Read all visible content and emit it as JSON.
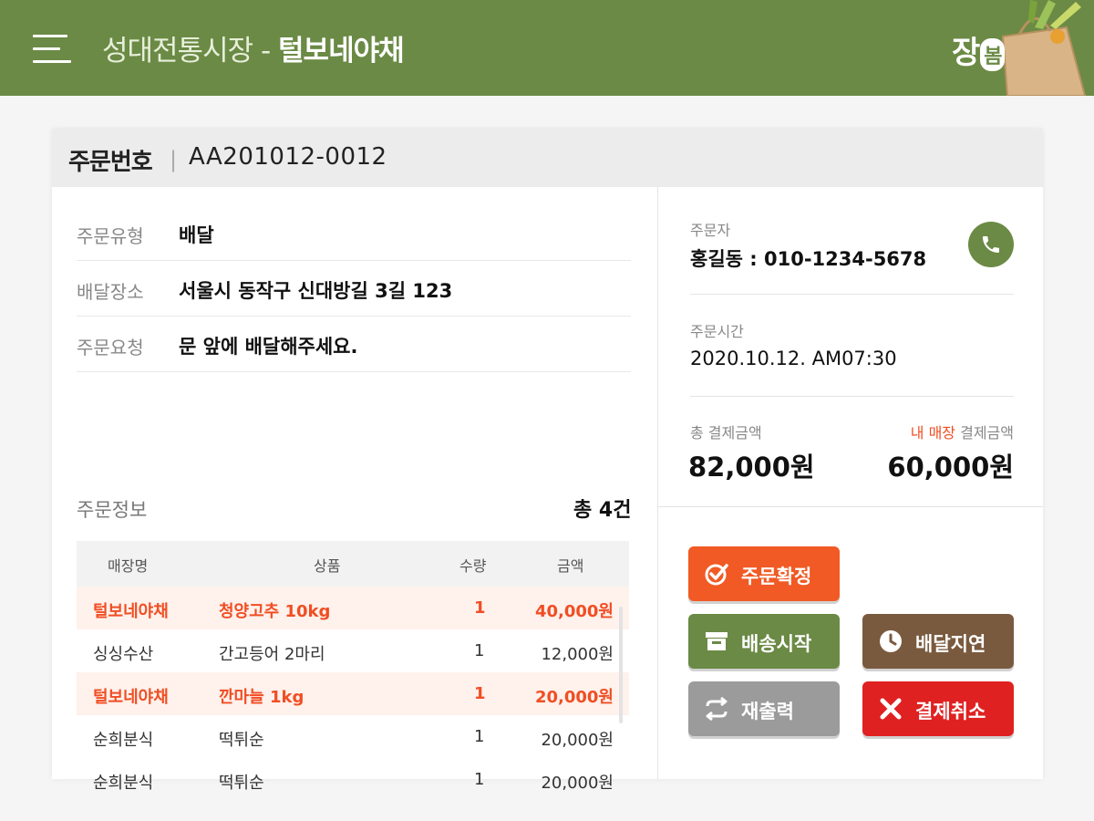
{
  "header": {
    "market_name": "성대전통시장",
    "separator": " - ",
    "shop_name": "털보네야채",
    "logo_text": "장",
    "logo_badge": "봄"
  },
  "order": {
    "number_label": "주문번호",
    "number": "AA201012-0012"
  },
  "details": [
    {
      "label": "주문유형",
      "value": "배달"
    },
    {
      "label": "배달장소",
      "value": "서울시 동작구 신대방길 3길 123"
    },
    {
      "label": "주문요청",
      "value": "문 앞에 배달해주세요."
    }
  ],
  "order_info": {
    "title": "주문정보",
    "total": "총 4건",
    "columns": [
      "매장명",
      "상품",
      "수량",
      "금액"
    ],
    "rows": [
      {
        "store": "털보네야채",
        "product": "청양고추 10kg",
        "qty": "1",
        "amount": "40,000원",
        "highlight": true
      },
      {
        "store": "싱싱수산",
        "product": "간고등어 2마리",
        "qty": "1",
        "amount": "12,000원",
        "highlight": false
      },
      {
        "store": "털보네야채",
        "product": "깐마늘 1kg",
        "qty": "1",
        "amount": "20,000원",
        "highlight": true
      },
      {
        "store": "순희분식",
        "product": "떡튀순",
        "qty": "1",
        "amount": "20,000원",
        "highlight": false
      },
      {
        "store": "순희분식",
        "product": "떡튀순",
        "qty": "1",
        "amount": "20,000원",
        "highlight": false
      }
    ]
  },
  "customer": {
    "label": "주문자",
    "value": "홍길동 : 010-1234-5678"
  },
  "order_time": {
    "label": "주문시간",
    "value": "2020.10.12.  AM07:30"
  },
  "payment": {
    "total_label": "총 결제금액",
    "total_value": "82,000원",
    "my_label_accent": "내 매장",
    "my_label_rest": " 결제금액",
    "my_value": "60,000원"
  },
  "buttons": {
    "confirm": "주문확정",
    "ship": "배송시작",
    "delay": "배달지연",
    "reprint": "재출력",
    "cancel": "결제취소"
  },
  "colors": {
    "brand_green": "#6b8a45",
    "accent_orange": "#f15a24",
    "highlight_red": "#f04e23",
    "delay_brown": "#7a5a3e",
    "cancel_red": "#e02121",
    "reprint_gray": "#9b9b9b"
  },
  "icons": {
    "menu": "hamburger-menu-icon",
    "call": "phone-icon",
    "confirm": "check-circle-icon",
    "ship": "box-icon",
    "delay": "clock-icon",
    "reprint": "refresh-icon",
    "cancel": "x-icon"
  }
}
